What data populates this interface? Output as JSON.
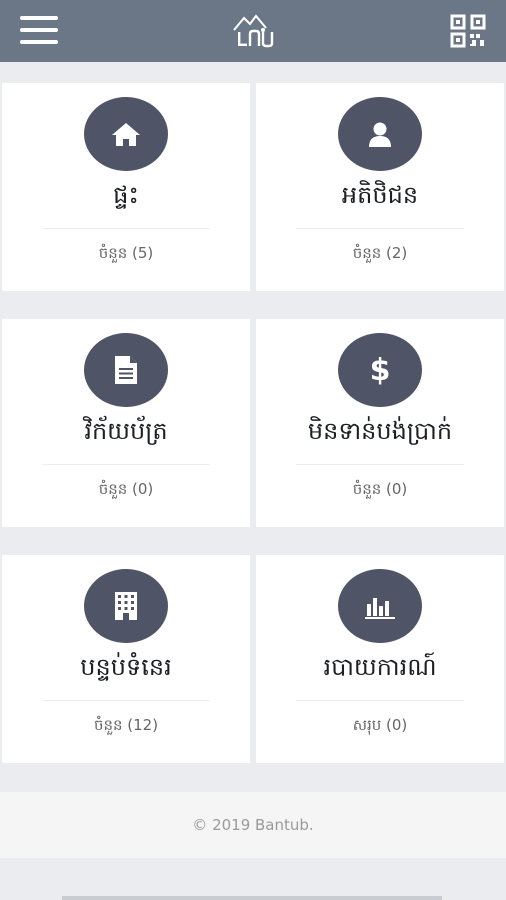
{
  "header": {
    "logo_text": "ᑕᑎᑌ",
    "menu_icon": "hamburger-icon",
    "qr_icon": "qr-code-icon"
  },
  "cards": [
    {
      "title": "ផ្ទះ",
      "count": "ចំនួន (5)",
      "icon": "home-icon"
    },
    {
      "title": "អតិថិជន",
      "count": "ចំនួន (2)",
      "icon": "user-icon"
    },
    {
      "title": "វិក័យប័ត្រ",
      "count": "ចំនួន (0)",
      "icon": "document-icon"
    },
    {
      "title": "មិនទាន់បង់ប្រាក់",
      "count": "ចំនួន (0)",
      "icon": "dollar-icon"
    },
    {
      "title": "បន្ទប់ទំនេរ",
      "count": "ចំនួន (12)",
      "icon": "building-icon"
    },
    {
      "title": "របាយការណ៍",
      "count": "សរុប (0)",
      "icon": "bar-chart-icon"
    }
  ],
  "footer": {
    "text": "© 2019 Bantub."
  },
  "colors": {
    "header": "#6b7787",
    "icon_circle": "#4f5466",
    "background": "#eaecef"
  }
}
